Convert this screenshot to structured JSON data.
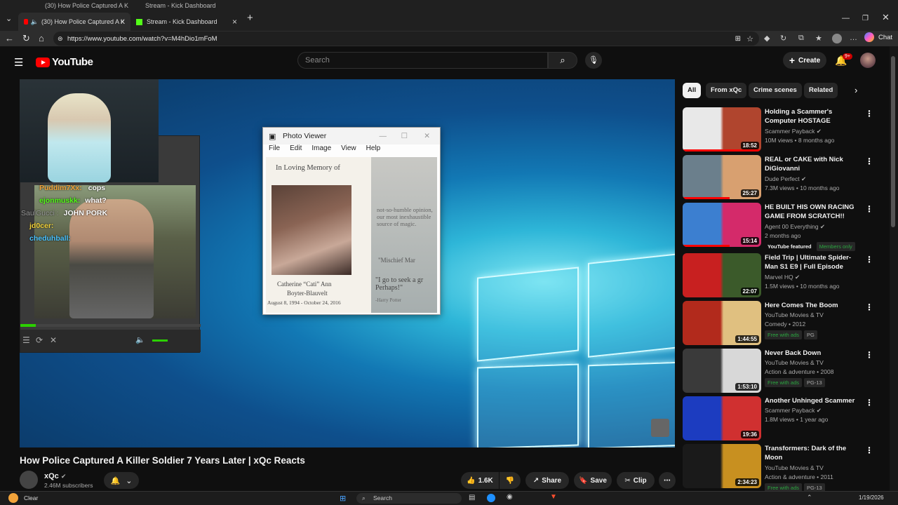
{
  "browser": {
    "ghost_tabs": [
      "(30) How Police Captured A K",
      "Stream - Kick Dashboard"
    ],
    "tabs": [
      {
        "label": "(30) How Police Captured A K",
        "active": true
      },
      {
        "label": "Stream - Kick Dashboard",
        "active": false
      }
    ],
    "url": "https://www.youtube.com/watch?v=M4hDio1mFoM",
    "chat_label": "Chat"
  },
  "header": {
    "logo_text": "YouTube",
    "search_placeholder": "Search",
    "create_label": "Create",
    "notification_badge": "9+"
  },
  "player": {
    "webcam_chat": [
      {
        "user": "Puddim7Xx:",
        "msg": "cops",
        "color": "#f2a33a"
      },
      {
        "user": "ejonmuskk:",
        "msg": "what?",
        "color": "#53fc18"
      },
      {
        "user": "SaulGucci :",
        "msg": "JOHN PORK",
        "color": "#9a9a9a"
      },
      {
        "user": "jd0cer:",
        "msg": "",
        "color": "#f2d23a"
      },
      {
        "user": "cheduhball:",
        "msg": "",
        "color": "#4ac3ff"
      }
    ],
    "photo_viewer": {
      "title": "Photo Viewer",
      "menu": [
        "File",
        "Edit",
        "Image",
        "View",
        "Help"
      ],
      "memorial_heading": "In Loving Memory of",
      "name_line1": "Catherine “Cati” Ann",
      "name_line2": "Boyter-Blauvelt",
      "dates": "August 8, 1994 - October 24, 2016",
      "quote1": "not-so-humble opinion, our most inexhaustible source of magic.",
      "quote2": "\"Mischief Mar",
      "quote3": "\"I go to seek a gr Perhaps!\"",
      "quote_author": "-Harry Potter"
    }
  },
  "video": {
    "title": "How Police Captured A Killer Soldier 7 Years Later | xQc Reacts",
    "channel": "xQc",
    "subscribers": "2.46M subscribers",
    "likes": "1.6K",
    "share_label": "Share",
    "save_label": "Save",
    "clip_label": "Clip"
  },
  "chips": [
    "All",
    "From xQc",
    "Crime scenes",
    "Related"
  ],
  "recommendations": [
    {
      "title": "Holding a Scammer's Computer HOSTAGE",
      "channel": "Scammer Payback",
      "meta": "10M views • 8 months ago",
      "duration": "18:52",
      "tags": [],
      "colors": [
        "#e8e8e8",
        "#b0452e"
      ]
    },
    {
      "title": "REAL or CAKE with Nick DiGiovanni",
      "channel": "Dude Perfect",
      "meta": "7.3M views • 10 months ago",
      "duration": "25:27",
      "tags": [],
      "colors": [
        "#6b7f8c",
        "#d8a070"
      ]
    },
    {
      "title": "HE BUILT HIS OWN RACING GAME FROM SCRATCH!!",
      "channel": "Agent 00 Everything",
      "meta": "2 months ago",
      "duration": "15:14",
      "tags": [
        "YouTube featured",
        "Members only"
      ],
      "colors": [
        "#3c7fd0",
        "#d42a6a"
      ]
    },
    {
      "title": "Field Trip | Ultimate Spider-Man S1 E9 | Full Episode",
      "channel": "Marvel HQ",
      "meta": "1.5M views • 10 months ago",
      "duration": "22:07",
      "tags": [],
      "colors": [
        "#c82020",
        "#3b5a2a"
      ]
    },
    {
      "title": "Here Comes The Boom",
      "channel": "YouTube Movies & TV",
      "meta": "Comedy • 2012",
      "duration": "1:44:55",
      "tags": [
        "Free with ads",
        "PG"
      ],
      "colors": [
        "#b22a1c",
        "#e0c080"
      ]
    },
    {
      "title": "Never Back Down",
      "channel": "YouTube Movies & TV",
      "meta": "Action & adventure • 2008",
      "duration": "1:53:10",
      "tags": [
        "Free with ads",
        "PG-13"
      ],
      "colors": [
        "#3a3a3a",
        "#d8d8d8"
      ]
    },
    {
      "title": "Another Unhinged Scammer",
      "channel": "Scammer Payback",
      "meta": "1.8M views • 1 year ago",
      "duration": "19:36",
      "tags": [],
      "colors": [
        "#1c3cc0",
        "#d03030"
      ]
    },
    {
      "title": "Transformers: Dark of the Moon",
      "channel": "YouTube Movies & TV",
      "meta": "Action & adventure • 2011",
      "duration": "2:34:23",
      "tags": [
        "Free with ads",
        "PG-13"
      ],
      "colors": [
        "#1a1a1a",
        "#c89020"
      ]
    }
  ],
  "taskbar": {
    "weather": "Clear",
    "search": "Search",
    "date": "1/19/2026"
  }
}
